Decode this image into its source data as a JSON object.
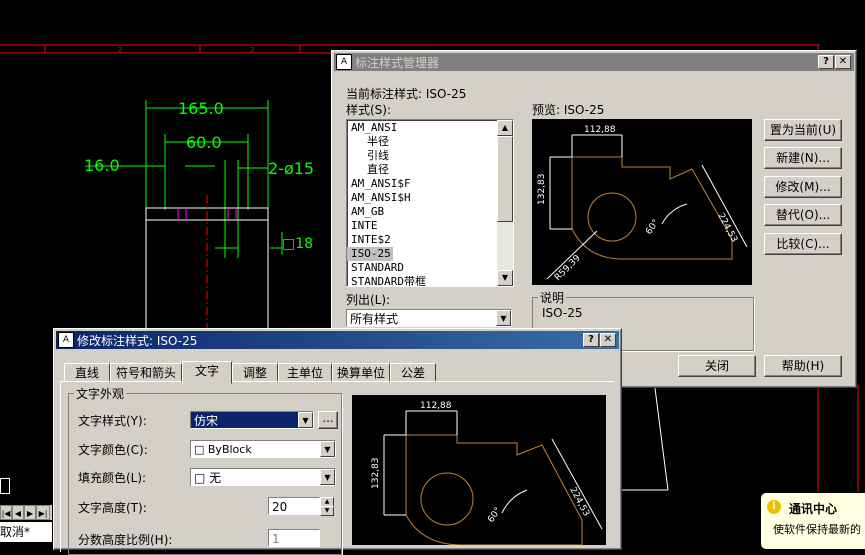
{
  "cad": {
    "dim_165": "165.0",
    "dim_60": "60.0",
    "dim_16": "16.0",
    "dim_phi15": "2-ø15",
    "dim_box18": "□18",
    "ruler_mark": "2",
    "command_text": "取消*",
    "colors": {
      "dim": "#00ff00",
      "ruler": "#ff0000",
      "outline": "#ffffff",
      "magenta": "#ff00ff"
    }
  },
  "manager": {
    "title": "标注样式管理器",
    "help_btn": "?",
    "close_btn": "✕",
    "current_style_label": "当前标注样式: ISO-25",
    "styles_label": "样式(S):",
    "preview_label": "预览: ISO-25",
    "styles": [
      "AM_ANSI",
      "半径",
      "引线",
      "直径",
      "AM_ANSI$F",
      "AM_ANSI$H",
      "AM_GB",
      "INTE",
      "INTE$2",
      "ISO-25",
      "STANDARD",
      "STANDARD带框"
    ],
    "selected_style": "ISO-25",
    "list_label": "列出(L):",
    "list_value": "所有样式",
    "desc_label": "说明",
    "desc_value": "ISO-25",
    "buttons": {
      "set_current": "置为当前(U)",
      "new": "新建(N)...",
      "modify": "修改(M)...",
      "override": "替代(O)...",
      "compare": "比较(C)...",
      "close": "关闭",
      "help": "帮助(H)"
    }
  },
  "preview_dims": {
    "top": "112,88",
    "left": "132,83",
    "right": "224,53",
    "angle": "60°",
    "radius": "R59,39"
  },
  "modify": {
    "title": "修改标注样式: ISO-25",
    "help_btn": "?",
    "close_btn": "✕",
    "tabs": [
      "直线",
      "符号和箭头",
      "文字",
      "调整",
      "主单位",
      "换算单位",
      "公差"
    ],
    "active_tab": "文字",
    "group_title": "文字外观",
    "text_style_label": "文字样式(Y):",
    "text_style_value": "仿宋",
    "text_style_more": "...",
    "text_color_label": "文字颜色(C):",
    "text_color_value": "□ ByBlock",
    "fill_color_label": "填充颜色(L):",
    "fill_color_value": "□ 无",
    "text_height_label": "文字高度(T):",
    "text_height_value": "20",
    "fraction_label": "分数高度比例(H):",
    "fraction_value": "1"
  },
  "notify": {
    "title": "通讯中心",
    "text": "使软件保持最新的"
  }
}
